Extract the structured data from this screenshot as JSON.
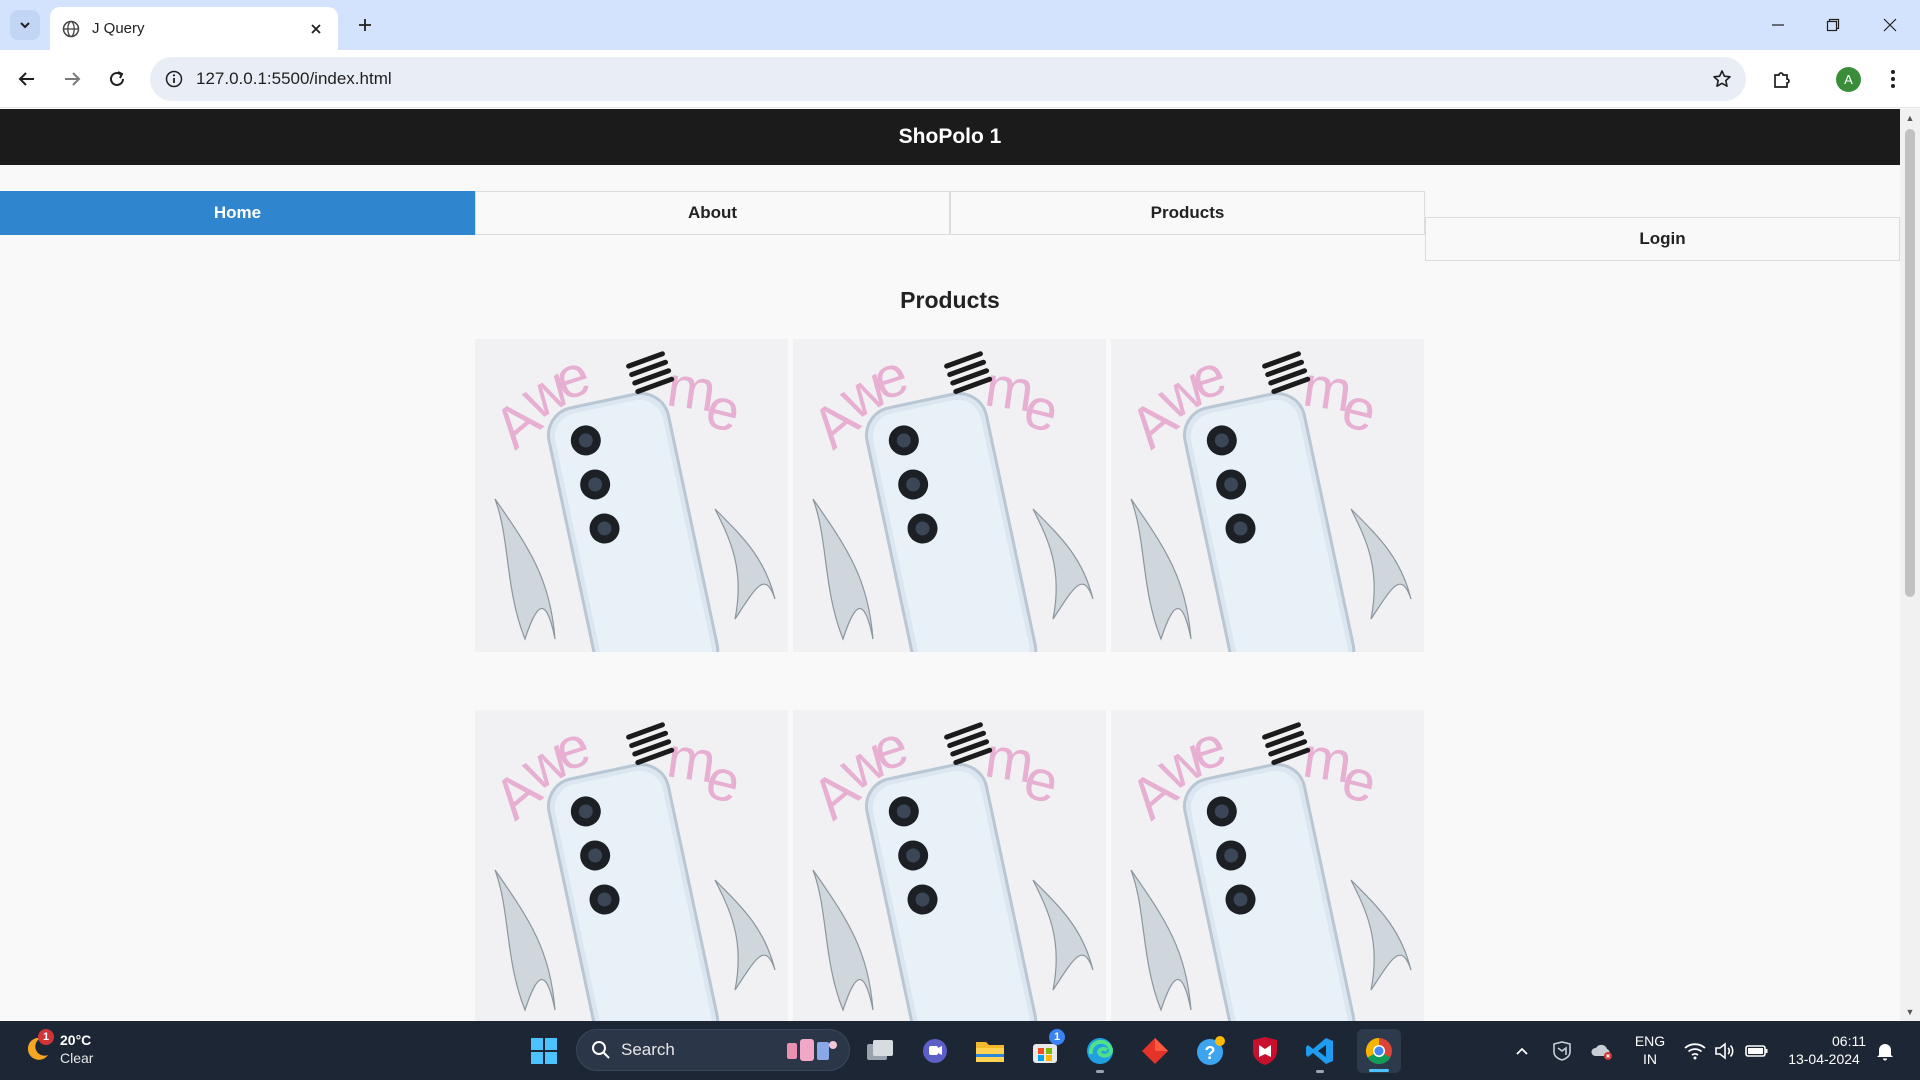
{
  "browser": {
    "tab_title": "J Query",
    "url": "127.0.0.1:5500/index.html",
    "profile_initial": "A"
  },
  "site": {
    "brand": "ShoPolo 1",
    "nav": [
      {
        "label": "Home",
        "active": true
      },
      {
        "label": "About",
        "active": false
      },
      {
        "label": "Products",
        "active": false
      }
    ],
    "login_label": "Login",
    "section_title": "Products",
    "product_image_text": "Awesome",
    "accent_color": "#2f86cf",
    "header_color": "#1b1b1b"
  },
  "taskbar": {
    "weather_badge": "1",
    "temperature": "20°C",
    "condition": "Clear",
    "search_placeholder": "Search",
    "store_badge": "1",
    "language": "ENG",
    "region": "IN",
    "time": "06:11",
    "date": "13-04-2024"
  }
}
